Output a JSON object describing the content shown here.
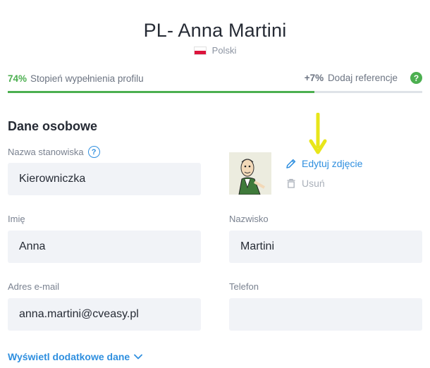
{
  "header": {
    "title": "PL- Anna Martini",
    "language": "Polski"
  },
  "progress": {
    "percent_label": "74%",
    "percent_value": 74,
    "label": "Stopień wypełnienia profilu",
    "bonus_label": "+7%",
    "bonus_text": "Dodaj referencje",
    "help_glyph": "?"
  },
  "section": {
    "title": "Dane osobowe"
  },
  "fields": {
    "job_title": {
      "label": "Nazwa stanowiska",
      "value": "Kierowniczka"
    },
    "first_name": {
      "label": "Imię",
      "value": "Anna"
    },
    "last_name": {
      "label": "Nazwisko",
      "value": "Martini"
    },
    "email": {
      "label": "Adres e-mail",
      "value": "anna.martini@cveasy.pl"
    },
    "phone": {
      "label": "Telefon",
      "value": ""
    }
  },
  "photo_actions": {
    "edit_label": "Edytuj zdjęcie",
    "remove_label": "Usuń"
  },
  "footer": {
    "more_label": "Wyświetl dodatkowe dane"
  },
  "colors": {
    "accent": "#2f8fdf",
    "progress": "#4caf50",
    "annotation_arrow": "#e8e61a"
  },
  "icons": {
    "flag": "poland-flag-icon",
    "help": "question-icon",
    "edit": "pencil-icon",
    "remove": "trash-icon",
    "expand": "chevron-down-icon"
  }
}
